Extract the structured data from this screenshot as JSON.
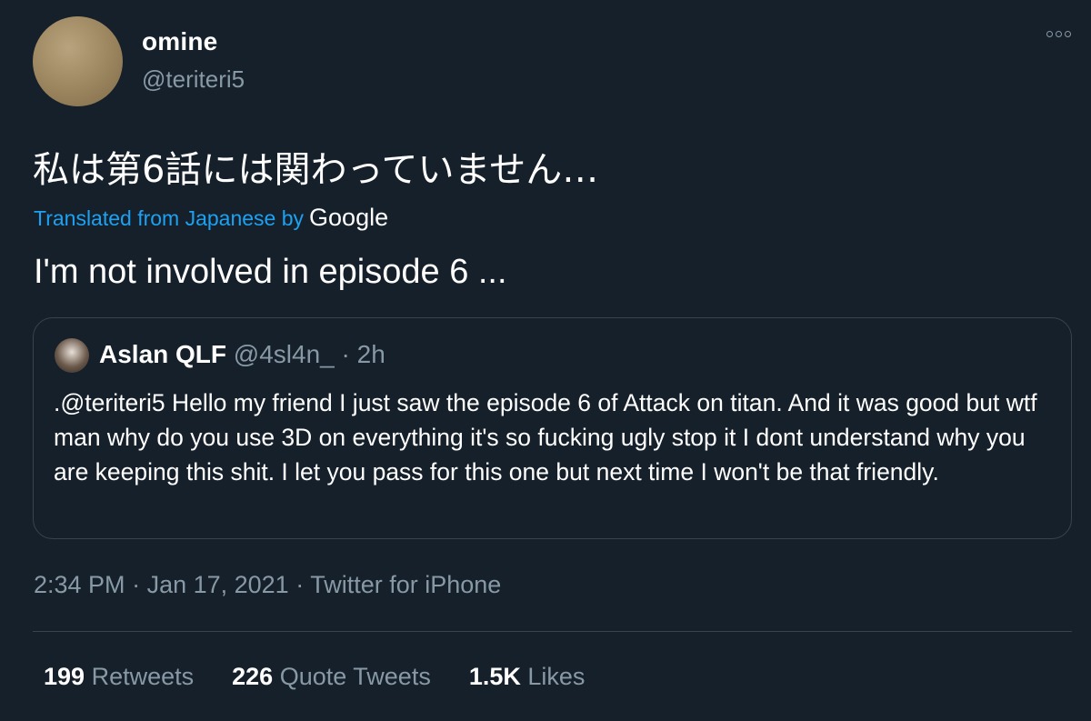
{
  "author": {
    "name": "omine",
    "handle": "@teriteri5"
  },
  "tweet": {
    "original_text": "私は第6話には関わっていません…",
    "translated_prefix": "Translated from Japanese by",
    "translator": "Google",
    "translated_text": "I'm not involved in episode 6 ..."
  },
  "quoted": {
    "name": "Aslan QLF",
    "handle": "@4sl4n_",
    "separator": " · ",
    "time": "2h",
    "text": ".@teriteri5 Hello my friend I just saw the episode 6 of Attack on titan. And it was good but wtf man why do you use 3D on everything it's so fucking ugly stop it I dont understand why you are keeping this shit. I let you pass for this one but next time I won't be that friendly."
  },
  "meta": {
    "time": "2:34 PM",
    "sep": " · ",
    "date": "Jan 17, 2021",
    "source": "Twitter for iPhone"
  },
  "stats": {
    "retweets_count": "199",
    "retweets_label": "Retweets",
    "quotes_count": "226",
    "quotes_label": "Quote Tweets",
    "likes_count": "1.5K",
    "likes_label": "Likes"
  },
  "colors": {
    "background": "#15202b",
    "secondary_text": "#8899a6",
    "accent": "#1da1f2",
    "border": "#38444d"
  },
  "icons": {
    "more": "more-dots-icon"
  }
}
